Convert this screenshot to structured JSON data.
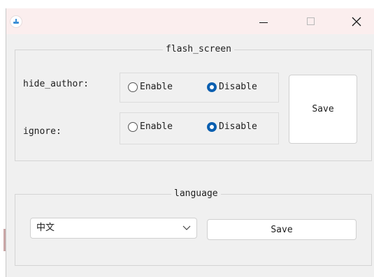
{
  "window": {
    "minimize_symbol": "—",
    "maximize_symbol": "☐",
    "close_symbol": "✕"
  },
  "flash_screen": {
    "title": "flash_screen",
    "rows": [
      {
        "label": "hide_author:",
        "options": [
          {
            "label": "Enable",
            "checked": false
          },
          {
            "label": "Disable",
            "checked": true
          }
        ]
      },
      {
        "label": "ignore:",
        "options": [
          {
            "label": "Enable",
            "checked": false
          },
          {
            "label": "Disable",
            "checked": true
          }
        ]
      }
    ],
    "save_label": "Save"
  },
  "language": {
    "title": "language",
    "selected": "中文",
    "save_label": "Save"
  },
  "colors": {
    "titlebar": "#fbeeee",
    "window_bg": "#f0f0f0",
    "radio_checked": "#0a5fb0"
  }
}
